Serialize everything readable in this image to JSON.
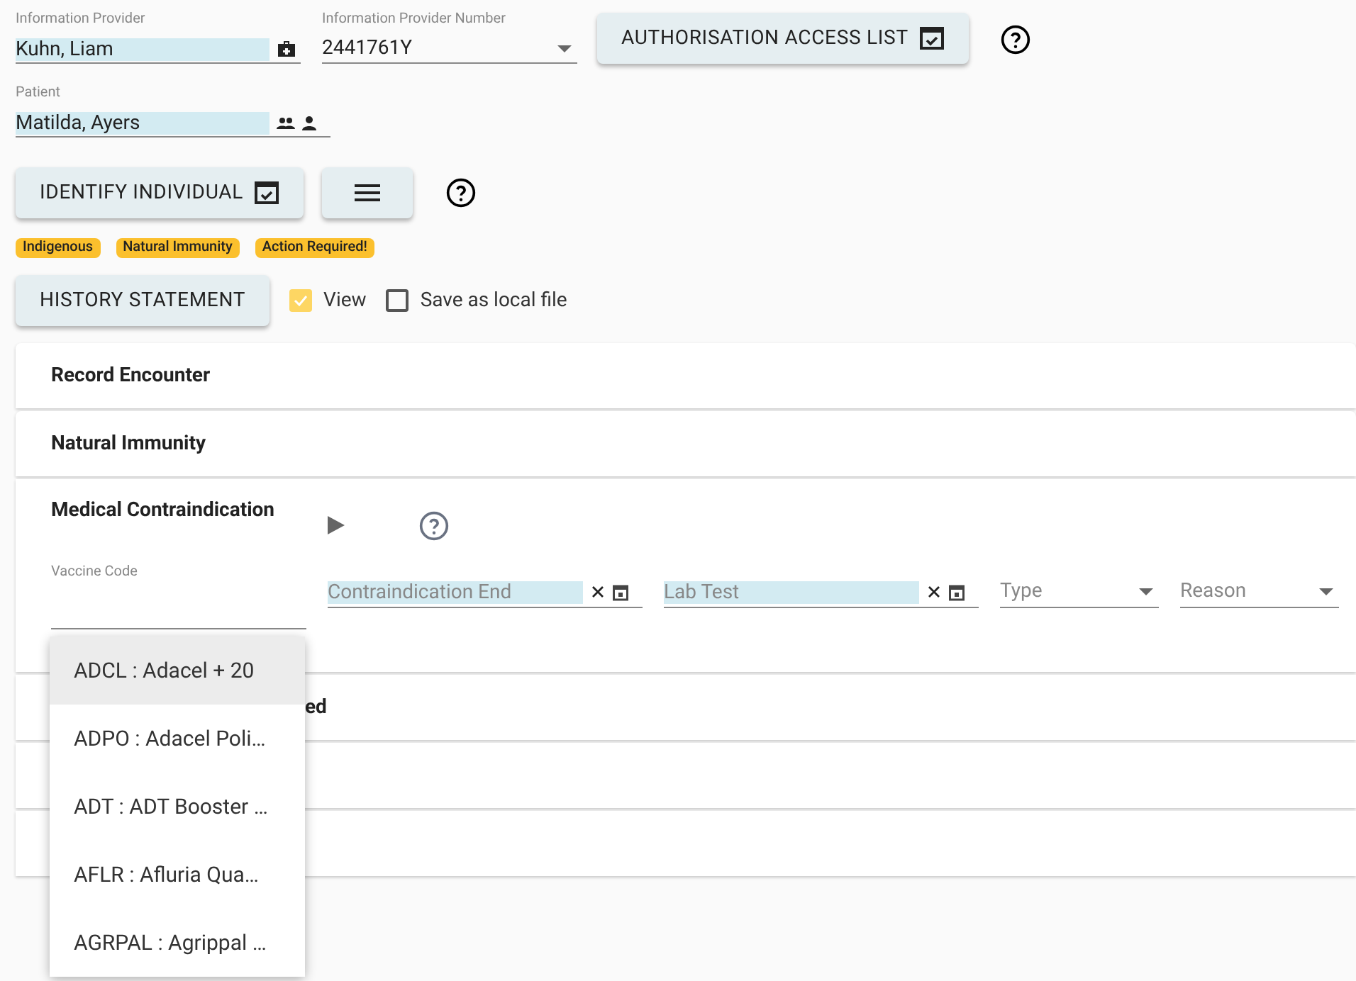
{
  "provider": {
    "label": "Information Provider",
    "value": "Kuhn, Liam"
  },
  "provider_number": {
    "label": "Information Provider Number",
    "value": "2441761Y"
  },
  "authorisation_button": "AUTHORISATION ACCESS LIST",
  "patient": {
    "label": "Patient",
    "value": "Matilda, Ayers"
  },
  "identify_button": "IDENTIFY INDIVIDUAL",
  "badges": [
    "Indigenous",
    "Natural Immunity",
    "Action Required!"
  ],
  "history_button": "HISTORY STATEMENT",
  "options": [
    {
      "label": "View",
      "checked": true
    },
    {
      "label": "Save as local file",
      "checked": false
    }
  ],
  "panels": [
    {
      "kind": "collapsed",
      "title": "Record Encounter"
    },
    {
      "kind": "collapsed",
      "title": "Natural Immunity"
    },
    {
      "kind": "expanded",
      "title": "Medical Contraindication",
      "fields": [
        {
          "kind": "combo",
          "label": "Vaccine Code"
        },
        {
          "kind": "date",
          "placeholder": "Contraindication End"
        },
        {
          "kind": "date",
          "placeholder": "Lab Test"
        },
        {
          "kind": "select",
          "placeholder": "Type"
        },
        {
          "kind": "select",
          "placeholder": "Reason"
        }
      ]
    },
    {
      "kind": "covered",
      "title": "ed"
    },
    {
      "kind": "covered"
    },
    {
      "kind": "covered"
    }
  ],
  "dropdown": [
    {
      "label": "ADCL : Adacel + 20",
      "selected": true
    },
    {
      "label": "ADPO : Adacel Poli…",
      "selected": false
    },
    {
      "label": "ADT : ADT Booster …",
      "selected": false
    },
    {
      "label": "AFLR : Afluria Qua…",
      "selected": false
    },
    {
      "label": "AGRPAL : Agrippal …",
      "selected": false
    }
  ]
}
